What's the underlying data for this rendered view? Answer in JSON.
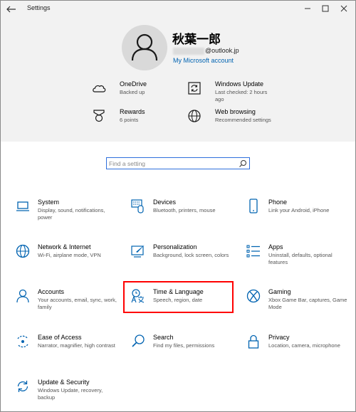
{
  "window": {
    "title": "Settings"
  },
  "user": {
    "name": "秋葉一郎",
    "email_domain": "@outlook.jp",
    "account_link": "My Microsoft account"
  },
  "header_items": [
    {
      "title": "OneDrive",
      "subtitle": "Backed up"
    },
    {
      "title": "Windows Update",
      "subtitle": "Last checked: 2 hours ago"
    },
    {
      "title": "Rewards",
      "subtitle": "6 points"
    },
    {
      "title": "Web browsing",
      "subtitle": "Recommended settings"
    }
  ],
  "search": {
    "placeholder": "Find a setting",
    "value": ""
  },
  "tiles": [
    {
      "title": "System",
      "desc": "Display, sound, notifications, power"
    },
    {
      "title": "Devices",
      "desc": "Bluetooth, printers, mouse"
    },
    {
      "title": "Phone",
      "desc": "Link your Android, iPhone"
    },
    {
      "title": "Network & Internet",
      "desc": "Wi-Fi, airplane mode, VPN"
    },
    {
      "title": "Personalization",
      "desc": "Background, lock screen, colors"
    },
    {
      "title": "Apps",
      "desc": "Uninstall, defaults, optional features"
    },
    {
      "title": "Accounts",
      "desc": "Your accounts, email, sync, work, family"
    },
    {
      "title": "Time & Language",
      "desc": "Speech, region, date"
    },
    {
      "title": "Gaming",
      "desc": "Xbox Game Bar, captures, Game Mode"
    },
    {
      "title": "Ease of Access",
      "desc": "Narrator, magnifier, high contrast"
    },
    {
      "title": "Search",
      "desc": "Find my files, permissions"
    },
    {
      "title": "Privacy",
      "desc": "Location, camera, microphone"
    },
    {
      "title": "Update & Security",
      "desc": "Windows Update, recovery, backup"
    }
  ],
  "colors": {
    "accent": "#0063b1",
    "highlight": "#ff0000",
    "header_bg": "#f2f2f2",
    "search_border": "#2f6fdc"
  }
}
